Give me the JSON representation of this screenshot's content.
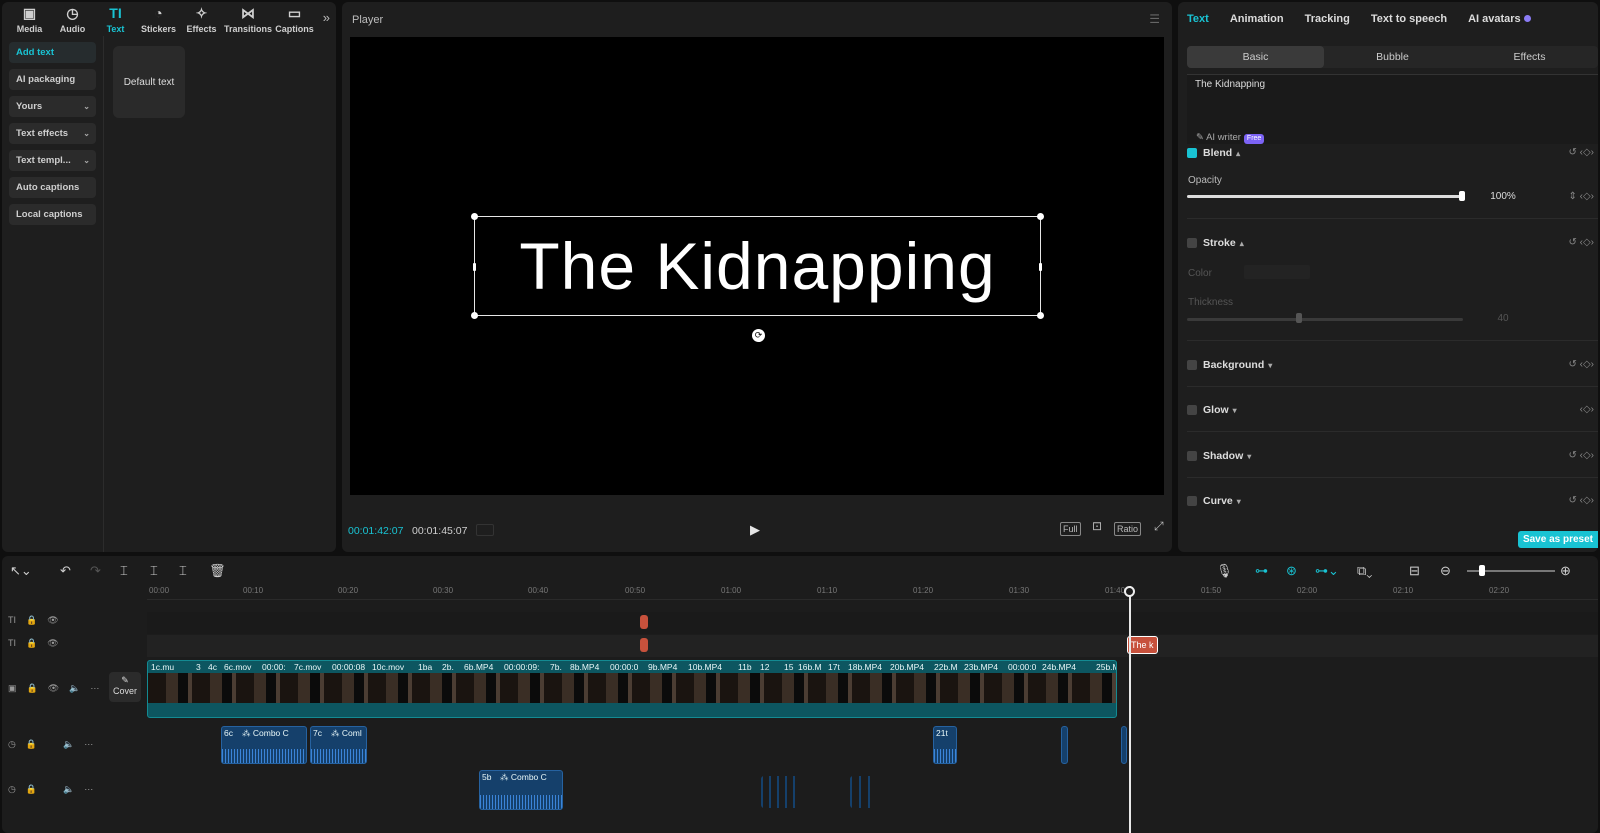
{
  "toolbar": {
    "items": [
      {
        "label": "Media",
        "icon": "media-icon",
        "glyph": "▣"
      },
      {
        "label": "Audio",
        "icon": "audio-icon",
        "glyph": "◷"
      },
      {
        "label": "Text",
        "icon": "text-icon",
        "glyph": "TI"
      },
      {
        "label": "Stickers",
        "icon": "stickers-icon",
        "glyph": "◔"
      },
      {
        "label": "Effects",
        "icon": "effects-icon",
        "glyph": "✧"
      },
      {
        "label": "Transitions",
        "icon": "transitions-icon",
        "glyph": "⋈"
      },
      {
        "label": "Captions",
        "icon": "captions-icon",
        "glyph": "▭"
      }
    ],
    "more": "»"
  },
  "sidebar": {
    "items": [
      {
        "label": "Add text",
        "dropdown": false
      },
      {
        "label": "AI packaging",
        "dropdown": false
      },
      {
        "label": "Yours",
        "dropdown": true
      },
      {
        "label": "Text effects",
        "dropdown": true
      },
      {
        "label": "Text templ...",
        "dropdown": true
      },
      {
        "label": "Auto captions",
        "dropdown": false
      },
      {
        "label": "Local captions",
        "dropdown": false
      }
    ],
    "card": "Default text"
  },
  "player": {
    "title": "Player",
    "overlay_text": "The Kidnapping",
    "current_time": "00:01:42:07",
    "total_time": "00:01:45:07",
    "buttons": [
      "Full",
      "Ratio"
    ]
  },
  "right": {
    "tabs": [
      "Text",
      "Animation",
      "Tracking",
      "Text to speech",
      "AI avatars"
    ],
    "subtabs": [
      "Basic",
      "Bubble",
      "Effects"
    ],
    "text_value": "The Kidnapping",
    "ai_writer": "AI writer",
    "ai_badge": "Free",
    "blend": "Blend",
    "opacity_label": "Opacity",
    "opacity_value": "100%",
    "opacity": 1.0,
    "stroke": "Stroke",
    "color_label": "Color",
    "thickness_label": "Thickness",
    "thickness_value": "40",
    "background": "Background",
    "glow": "Glow",
    "shadow": "Shadow",
    "curve": "Curve",
    "save_preset": "Save as preset"
  },
  "timeline": {
    "ruler": [
      "00:00",
      "00:10",
      "00:20",
      "00:30",
      "00:40",
      "00:50",
      "01:00",
      "01:10",
      "01:20",
      "01:30",
      "01:40",
      "01:50",
      "02:00",
      "02:10",
      "02:20"
    ],
    "cover_label": "Cover",
    "text_clip": "The k",
    "video_clips": [
      "1c.mu",
      "3",
      "4c",
      "6c.mov",
      "00:00:",
      "7c.mov",
      "00:00:08",
      "10c.mov",
      "1ba",
      "2b.",
      "6b.MP4",
      "00:00:09:",
      "7b.",
      "8b.MP4",
      "00:00:0",
      "9b.MP4",
      "10b.MP4",
      "11b",
      "12",
      "15",
      "16b.M",
      "17t",
      "18b.MP4",
      "20b.MP4",
      "22b.M",
      "23b.MP4",
      "00:00:0",
      "24b.MP4",
      "25b.M"
    ],
    "audio1_clips": [
      "6c",
      "Combo C",
      "7c",
      "Coml",
      "21t"
    ],
    "audio2_clips": [
      "5b",
      "Combo C"
    ]
  }
}
